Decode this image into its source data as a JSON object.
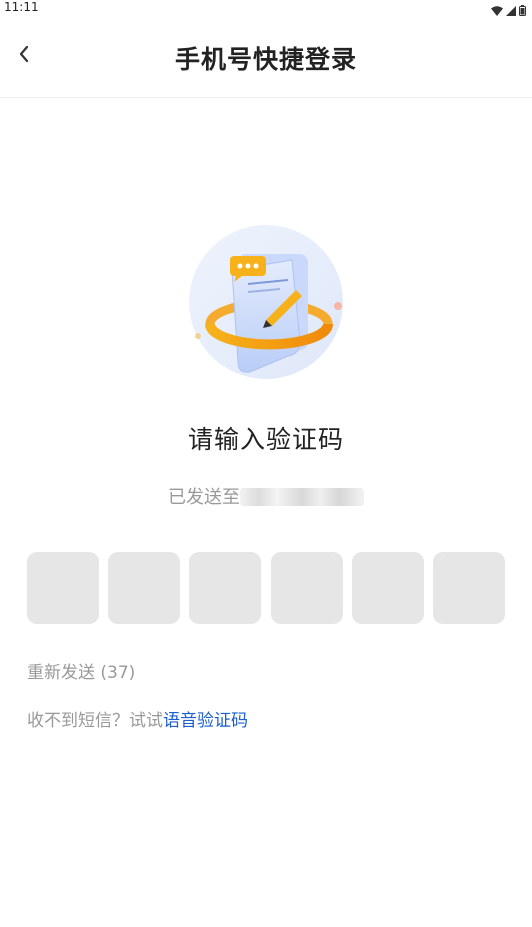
{
  "status_bar": {
    "time": "11:11"
  },
  "nav": {
    "title": "手机号快捷登录"
  },
  "main": {
    "heading": "请输入验证码",
    "sent_prefix": "已发送至",
    "code_boxes": [
      "",
      "",
      "",
      "",
      "",
      ""
    ],
    "resend_label": "重新发送 (37)",
    "help_prefix": "收不到短信？试试",
    "voice_link": "语音验证码"
  },
  "colors": {
    "link": "#1a5fcf",
    "muted_text": "#999999",
    "box_bg": "#e6e6e6",
    "accent_orange": "#f5a623"
  },
  "icons": [
    "back-chevron-icon",
    "wifi-icon",
    "signal-icon",
    "battery-icon",
    "sms-illustration"
  ]
}
